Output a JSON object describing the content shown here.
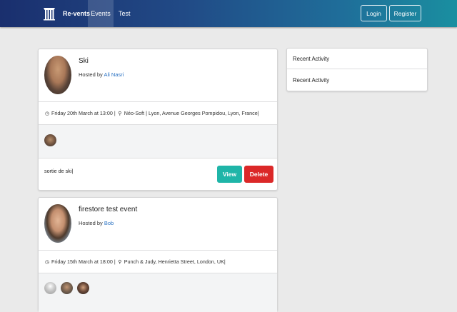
{
  "nav": {
    "logo_icon": "pillars-logo-icon",
    "brand": "Re-vents",
    "items": [
      "Events",
      "Test"
    ],
    "login": "Login",
    "register": "Register"
  },
  "events": [
    {
      "title": "Ski",
      "hosted_prefix": "Hosted by ",
      "host": "Ali Nasri",
      "date": "Friday 20th March at 13:00 |",
      "venue": "Néo-Soft",
      "address": "| Lyon, Avenue Georges Pompidou, Lyon, France|",
      "description": "sortie de ski|",
      "view_label": "View",
      "delete_label": "Delete"
    },
    {
      "title": "firestore test event",
      "hosted_prefix": "Hosted by ",
      "host": "Bob",
      "date": "Friday 15th March at 18:00 |",
      "venue": "Punch & Judy, Henrietta Street, London, UK|"
    }
  ],
  "sidebar": {
    "rows": [
      "Recent Activity",
      "Recent Activity"
    ]
  },
  "colors": {
    "accent_teal": "#1fb5a8",
    "danger_red": "#db2828",
    "link_blue": "#2a72c3"
  }
}
